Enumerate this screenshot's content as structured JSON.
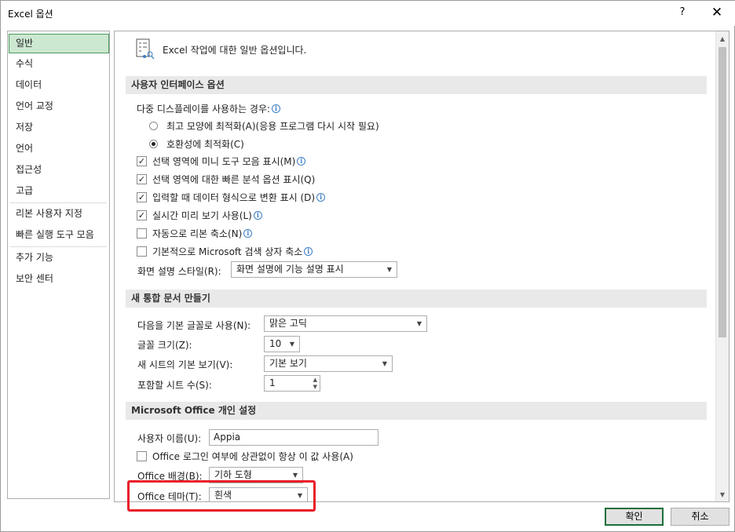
{
  "window": {
    "title": "Excel 옵션",
    "help": "?",
    "close": "✕"
  },
  "nav": {
    "items": [
      {
        "label": "일반",
        "selected": true
      },
      {
        "label": "수식"
      },
      {
        "label": "데이터"
      },
      {
        "label": "언어 교정"
      },
      {
        "label": "저장"
      },
      {
        "label": "언어"
      },
      {
        "label": "접근성"
      },
      {
        "label": "고급"
      },
      {
        "label": "리본 사용자 지정"
      },
      {
        "label": "빠른 실행 도구 모음"
      },
      {
        "label": "추가 기능"
      },
      {
        "label": "보안 센터"
      }
    ]
  },
  "header": {
    "text": "Excel 작업에 대한 일반 옵션입니다."
  },
  "ui_options": {
    "title": "사용자 인터페이스 옵션",
    "multi_display_label": "다중 디스플레이를 사용하는 경우:",
    "radio_appearance": "최고 모양에 최적화(A)(응용 프로그램 다시 시작 필요)",
    "radio_compat": "호환성에 최적화(C)",
    "mini_toolbar": "선택 영역에 미니 도구 모음 표시(M)",
    "quick_analysis": "선택 영역에 대한 빠른 분석 옵션 표시(Q)",
    "convert_format": "입력할 때 데이터 형식으로 변환 표시 (D)",
    "live_preview": "실시간 미리 보기 사용(L)",
    "collapse_ribbon": "자동으로 리본 축소(N)",
    "collapse_search": "기본적으로 Microsoft 검색 상자 축소",
    "screentip_label": "화면 설명 스타일(R):",
    "screentip_value": "화면 설명에 기능 설명 표시"
  },
  "new_workbook": {
    "title": "새 통합 문서 만들기",
    "font_label": "다음을 기본 글꼴로 사용(N):",
    "font_value": "맑은 고딕",
    "size_label": "글꼴 크기(Z):",
    "size_value": "10",
    "view_label": "새 시트의 기본 보기(V):",
    "view_value": "기본 보기",
    "sheets_label": "포함할 시트 수(S):",
    "sheets_value": "1"
  },
  "personalize": {
    "title": "Microsoft Office 개인 설정",
    "username_label": "사용자 이름(U):",
    "username_value": "Appia",
    "always_use": "Office 로그인 여부에 상관없이 항상 이 값 사용(A)",
    "background_label": "Office 배경(B):",
    "background_value": "기하 도형",
    "theme_label": "Office 테마(T):",
    "theme_value": "흰색"
  },
  "buttons": {
    "ok": "확인",
    "cancel": "취소"
  },
  "colors": {
    "selected_nav_bg": "#cde8d1",
    "highlight": "#e81e2a",
    "primary_border": "#1b6e3a"
  }
}
